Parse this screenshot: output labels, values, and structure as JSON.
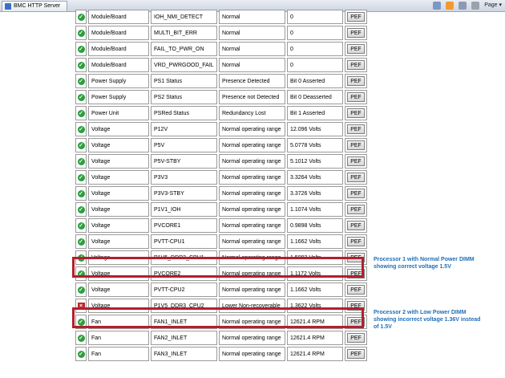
{
  "browser": {
    "tab_title": "BMC HTTP Server",
    "page_menu": "Page ▾"
  },
  "table": {
    "pef_label": "PEF",
    "rows": [
      {
        "status": "ok",
        "type": "Module/Board",
        "name": "IOH_NMI_DETECT",
        "state": "Normal",
        "reading": "0"
      },
      {
        "status": "ok",
        "type": "Module/Board",
        "name": "MULTI_BIT_ERR",
        "state": "Normal",
        "reading": "0"
      },
      {
        "status": "ok",
        "type": "Module/Board",
        "name": "FAIL_TO_PWR_ON",
        "state": "Normal",
        "reading": "0"
      },
      {
        "status": "ok",
        "type": "Module/Board",
        "name": "VRD_PWRGOOD_FAIL",
        "state": "Normal",
        "reading": "0"
      },
      {
        "status": "ok",
        "type": "Power Supply",
        "name": "PS1 Status",
        "state": "Presence Detected",
        "reading": "Bit 0 Asserted"
      },
      {
        "status": "ok",
        "type": "Power Supply",
        "name": "PS2 Status",
        "state": "Presence not Detected",
        "reading": "Bit 0 Deasserted"
      },
      {
        "status": "ok",
        "type": "Power Unit",
        "name": "PSRed Status",
        "state": "Redundancy Lost",
        "reading": "Bit 1 Asserted"
      },
      {
        "status": "ok",
        "type": "Voltage",
        "name": "P12V",
        "state": "Normal operating range",
        "reading": "12.096 Volts"
      },
      {
        "status": "ok",
        "type": "Voltage",
        "name": "P5V",
        "state": "Normal operating range",
        "reading": "5.0778 Volts"
      },
      {
        "status": "ok",
        "type": "Voltage",
        "name": "P5V-STBY",
        "state": "Normal operating range",
        "reading": "5.1012 Volts"
      },
      {
        "status": "ok",
        "type": "Voltage",
        "name": "P3V3",
        "state": "Normal operating range",
        "reading": "3.3264 Volts"
      },
      {
        "status": "ok",
        "type": "Voltage",
        "name": "P3V3-STBY",
        "state": "Normal operating range",
        "reading": "3.3726 Volts"
      },
      {
        "status": "ok",
        "type": "Voltage",
        "name": "P1V1_IOH",
        "state": "Normal operating range",
        "reading": "1.1074 Volts"
      },
      {
        "status": "ok",
        "type": "Voltage",
        "name": "PVCORE1",
        "state": "Normal operating range",
        "reading": "0.9898 Volts"
      },
      {
        "status": "ok",
        "type": "Voltage",
        "name": "PVTT-CPU1",
        "state": "Normal operating range",
        "reading": "1.1662 Volts"
      },
      {
        "status": "ok",
        "type": "Voltage",
        "name": "P1V5_DDR3_CPU1",
        "state": "Normal operating range",
        "reading": "1.5092 Volts"
      },
      {
        "status": "ok",
        "type": "Voltage",
        "name": "PVCORE2",
        "state": "Normal operating range",
        "reading": "1.1172 Volts"
      },
      {
        "status": "ok",
        "type": "Voltage",
        "name": "PVTT-CPU2",
        "state": "Normal operating range",
        "reading": "1.1662 Volts"
      },
      {
        "status": "error",
        "type": "Voltage",
        "name": "P1V5_DDR3_CPU2",
        "state": "Lower Non-recoverable",
        "reading": "1.3622 Volts"
      },
      {
        "status": "ok",
        "type": "Fan",
        "name": "FAN1_INLET",
        "state": "Normal operating range",
        "reading": "12621.4 RPM"
      },
      {
        "status": "ok",
        "type": "Fan",
        "name": "FAN2_INLET",
        "state": "Normal operating range",
        "reading": "12621.4 RPM"
      },
      {
        "status": "ok",
        "type": "Fan",
        "name": "FAN3_INLET",
        "state": "Normal operating range",
        "reading": "12621.4 RPM"
      }
    ]
  },
  "annotations": {
    "cpu1_line1": "Processor 1 with Normal Power DIMM",
    "cpu1_line2": "showing correct voltage 1.5V",
    "cpu2_line1": "Processor 2 with Low Power DIMM",
    "cpu2_line2": "showing incorrect voltage 1.36V instead",
    "cpu2_line3": "of 1.5V"
  },
  "colors": {
    "ok_icon": "#2e9e3c",
    "error_icon": "#c0262d",
    "highlight": "#b1202c",
    "annotation_text": "#1f6fb8"
  }
}
